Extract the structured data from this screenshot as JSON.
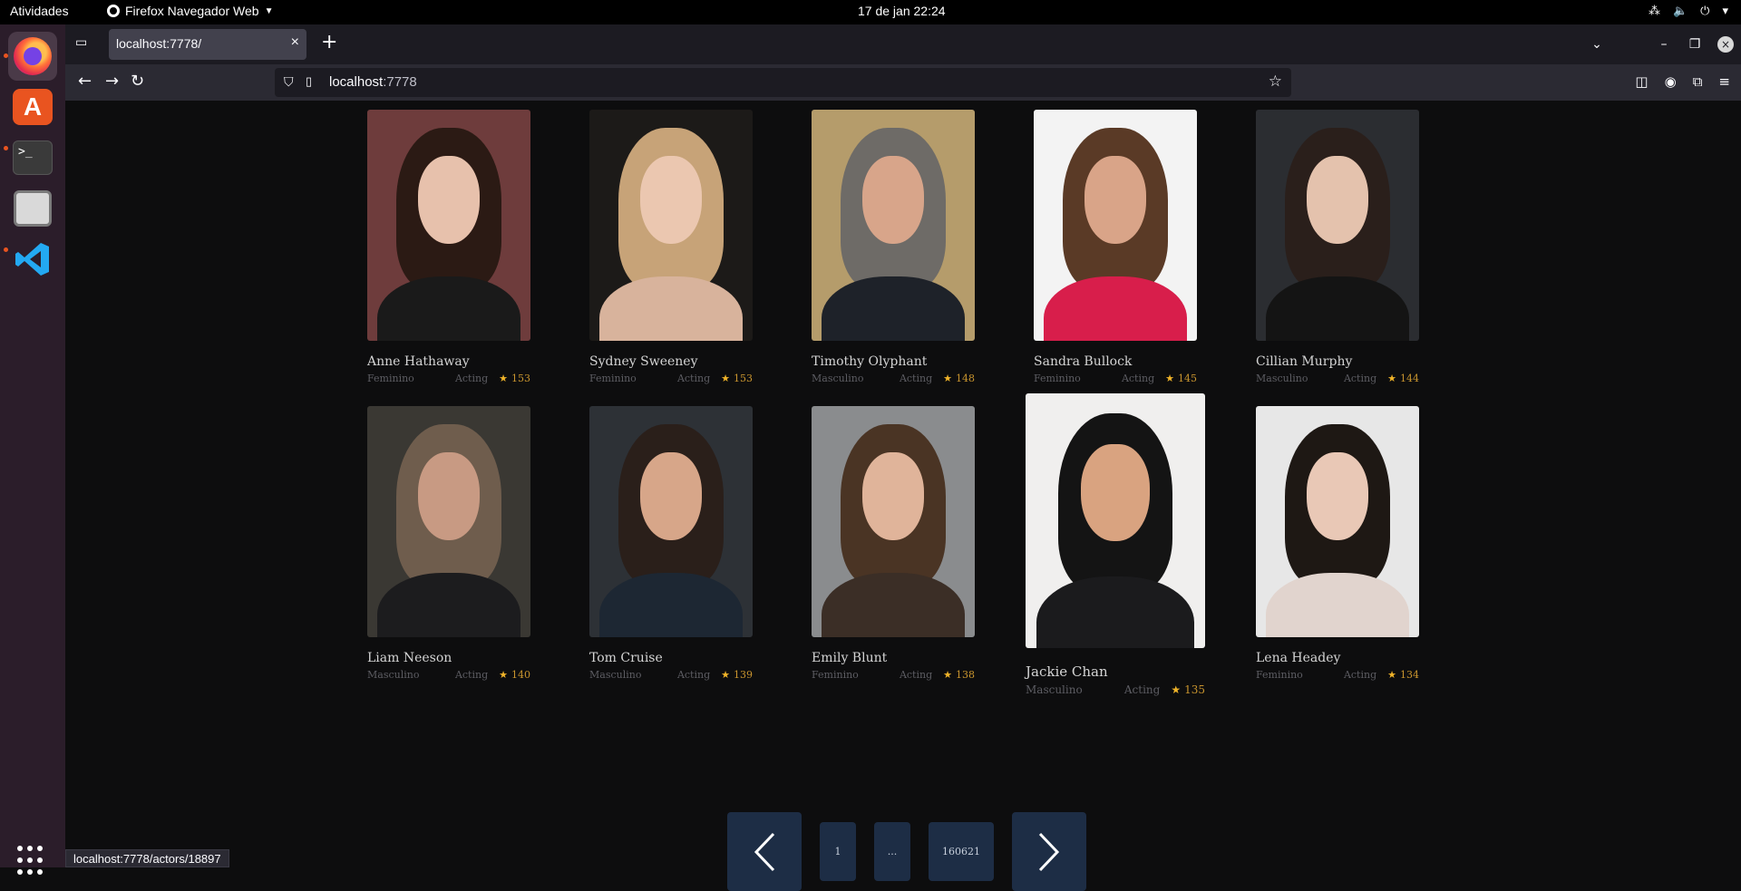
{
  "system": {
    "activities": "Atividades",
    "app_name": "Firefox Navegador Web",
    "clock": "17 de jan  22:24"
  },
  "browser": {
    "tab_title": "localhost:7778/",
    "url_host": "localhost",
    "url_port": ":7778",
    "status_url": "localhost:7778/actors/18897"
  },
  "actors": [
    {
      "name": "Anne Hathaway",
      "gender": "Feminino",
      "department": "Acting",
      "popularity": "153",
      "palette": [
        "#6e3c3c",
        "#2b1a14",
        "#e7c1ac",
        "#1a1a1a"
      ]
    },
    {
      "name": "Sydney Sweeney",
      "gender": "Feminino",
      "department": "Acting",
      "popularity": "153",
      "palette": [
        "#1c1a18",
        "#c7a378",
        "#ebc7b0",
        "#d8b39c"
      ]
    },
    {
      "name": "Timothy Olyphant",
      "gender": "Masculino",
      "department": "Acting",
      "popularity": "148",
      "palette": [
        "#b59c6b",
        "#6e6b67",
        "#d8a58a",
        "#1e2229"
      ]
    },
    {
      "name": "Sandra Bullock",
      "gender": "Feminino",
      "department": "Acting",
      "popularity": "145",
      "palette": [
        "#f3f3f3",
        "#5a3a26",
        "#d9a488",
        "#d81e4b"
      ]
    },
    {
      "name": "Cillian Murphy",
      "gender": "Masculino",
      "department": "Acting",
      "popularity": "144",
      "palette": [
        "#2b2d31",
        "#2a1f1b",
        "#e4c2ad",
        "#141414"
      ]
    },
    {
      "name": "Liam Neeson",
      "gender": "Masculino",
      "department": "Acting",
      "popularity": "140",
      "palette": [
        "#3a3833",
        "#6f5d4d",
        "#c89a83",
        "#1c1c1e"
      ]
    },
    {
      "name": "Tom Cruise",
      "gender": "Masculino",
      "department": "Acting",
      "popularity": "139",
      "palette": [
        "#2d3136",
        "#2a1f1a",
        "#d7a689",
        "#1d2733"
      ]
    },
    {
      "name": "Emily Blunt",
      "gender": "Feminino",
      "department": "Acting",
      "popularity": "138",
      "palette": [
        "#8a8c8e",
        "#4a3424",
        "#e0b49a",
        "#3b2e26"
      ]
    },
    {
      "name": "Jackie Chan",
      "gender": "Masculino",
      "department": "Acting",
      "popularity": "135",
      "palette": [
        "#f0efee",
        "#141414",
        "#d9a380",
        "#1b1b1d"
      ]
    },
    {
      "name": "Lena Headey",
      "gender": "Feminino",
      "department": "Acting",
      "popularity": "134",
      "palette": [
        "#e7e7e7",
        "#1e1814",
        "#e9c8b6",
        "#e1d4ce"
      ]
    }
  ],
  "pagination": {
    "prev": "<",
    "first": "1",
    "ellipsis": "...",
    "last": "160621",
    "next": ">"
  },
  "colors": {
    "page_bg": "#0d0d0e",
    "pager_bg": "#1d2d45",
    "rating": "#c9952e"
  }
}
